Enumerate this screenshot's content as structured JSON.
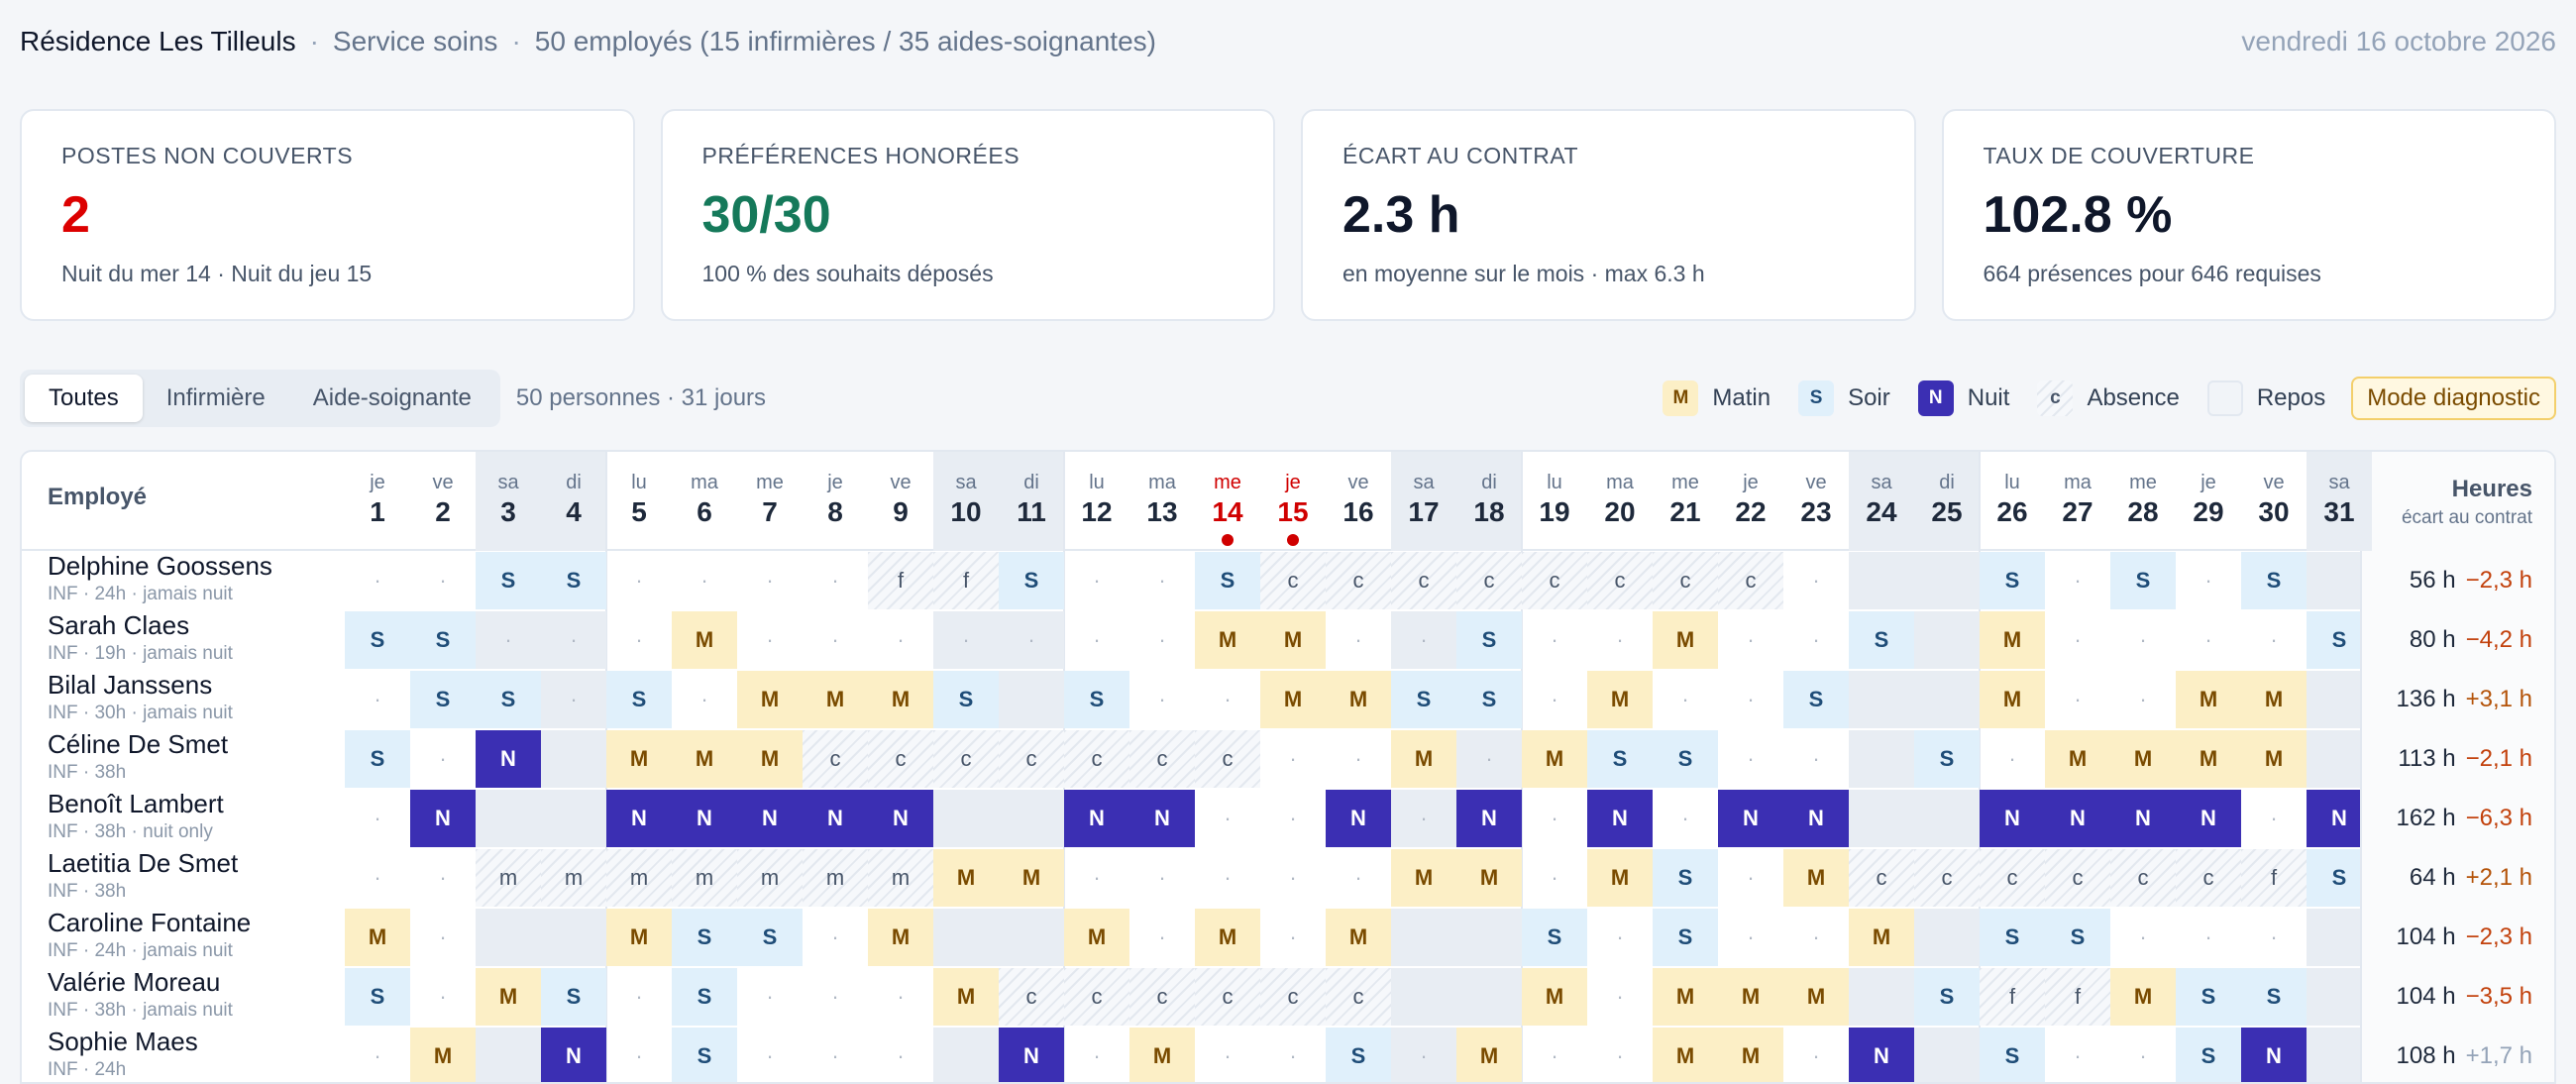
{
  "header": {
    "title": "Résidence Les Tilleuls",
    "service": "Service soins",
    "staff": "50 employés (15 infirmières / 35 aides-soignantes)",
    "date": "vendredi 16 octobre 2026"
  },
  "kpis": [
    {
      "label": "POSTES NON COUVERTS",
      "value": "2",
      "sub": "Nuit du mer 14 · Nuit du jeu 15",
      "tone": "red"
    },
    {
      "label": "PRÉFÉRENCES HONORÉES",
      "value": "30/30",
      "sub": "100 % des souhaits déposés",
      "tone": "green"
    },
    {
      "label": "ÉCART AU CONTRAT",
      "value": "2.3 h",
      "sub": "en moyenne sur le mois · max 6.3 h",
      "tone": ""
    },
    {
      "label": "TAUX DE COUVERTURE",
      "value": "102.8 %",
      "sub": "664 présences pour 646 requises",
      "tone": ""
    }
  ],
  "filters": {
    "all": "Toutes",
    "nurse": "Infirmière",
    "aide": "Aide-soignante",
    "count": "50 personnes · 31 jours"
  },
  "legend": {
    "matin": "Matin",
    "soir": "Soir",
    "nuit": "Nuit",
    "absence": "Absence",
    "repos": "Repos",
    "m_glyph": "M",
    "s_glyph": "S",
    "n_glyph": "N",
    "a_glyph": "c",
    "diagnostic": "Mode diagnostic",
    "colors": {
      "matin": "#fcefc6",
      "soir": "#e0f0fb",
      "nuit": "#3b2fb3",
      "absence": "#e3e8ef",
      "alert": "#d00000"
    }
  },
  "table": {
    "employee_header": "Employé",
    "hours_header": "Heures",
    "hours_sub": "écart au contrat",
    "days": [
      {
        "dn": "je",
        "dd": "1"
      },
      {
        "dn": "ve",
        "dd": "2"
      },
      {
        "dn": "sa",
        "dd": "3"
      },
      {
        "dn": "di",
        "dd": "4"
      },
      {
        "dn": "lu",
        "dd": "5"
      },
      {
        "dn": "ma",
        "dd": "6"
      },
      {
        "dn": "me",
        "dd": "7"
      },
      {
        "dn": "je",
        "dd": "8"
      },
      {
        "dn": "ve",
        "dd": "9"
      },
      {
        "dn": "sa",
        "dd": "10"
      },
      {
        "dn": "di",
        "dd": "11"
      },
      {
        "dn": "lu",
        "dd": "12"
      },
      {
        "dn": "ma",
        "dd": "13"
      },
      {
        "dn": "me",
        "dd": "14"
      },
      {
        "dn": "je",
        "dd": "15"
      },
      {
        "dn": "ve",
        "dd": "16"
      },
      {
        "dn": "sa",
        "dd": "17"
      },
      {
        "dn": "di",
        "dd": "18"
      },
      {
        "dn": "lu",
        "dd": "19"
      },
      {
        "dn": "ma",
        "dd": "20"
      },
      {
        "dn": "me",
        "dd": "21"
      },
      {
        "dn": "je",
        "dd": "22"
      },
      {
        "dn": "ve",
        "dd": "23"
      },
      {
        "dn": "sa",
        "dd": "24"
      },
      {
        "dn": "di",
        "dd": "25"
      },
      {
        "dn": "lu",
        "dd": "26"
      },
      {
        "dn": "ma",
        "dd": "27"
      },
      {
        "dn": "me",
        "dd": "28"
      },
      {
        "dn": "je",
        "dd": "29"
      },
      {
        "dn": "ve",
        "dd": "30"
      },
      {
        "dn": "sa",
        "dd": "31"
      }
    ],
    "rows": [
      {
        "name": "Delphine Goossens",
        "meta": "INF · 24h · jamais nuit",
        "hours": "56 h",
        "ecart": "−2,3 h",
        "tone": "neg",
        "shifts": [
          "·",
          "·",
          "S",
          "S",
          "·",
          "·",
          "·",
          "·",
          "f",
          "f",
          "S",
          "·",
          "·",
          "S",
          "c",
          "c",
          "c",
          "c",
          "c",
          "c",
          "c",
          "c",
          "·",
          "",
          "",
          "S",
          "·",
          "S",
          "·",
          "S",
          ""
        ]
      },
      {
        "name": "Sarah Claes",
        "meta": "INF · 19h · jamais nuit",
        "hours": "80 h",
        "ecart": "−4,2 h",
        "tone": "neg",
        "shifts": [
          "S",
          "S",
          "·",
          "·",
          "·",
          "M",
          "·",
          "·",
          "·",
          "·",
          "·",
          "·",
          "·",
          "M",
          "M",
          "·",
          "·",
          "S",
          "·",
          "·",
          "M",
          "·",
          "·",
          "S",
          "",
          "M",
          "·",
          "·",
          "·",
          "·",
          "S"
        ]
      },
      {
        "name": "Bilal Janssens",
        "meta": "INF · 30h · jamais nuit",
        "hours": "136 h",
        "ecart": "+3,1 h",
        "tone": "pos",
        "shifts": [
          "·",
          "S",
          "S",
          "·",
          "S",
          "·",
          "M",
          "M",
          "M",
          "S",
          "",
          "S",
          "·",
          "·",
          "M",
          "M",
          "S",
          "S",
          "·",
          "M",
          "·",
          "·",
          "S",
          "",
          "",
          "M",
          "·",
          "·",
          "M",
          "M",
          ""
        ]
      },
      {
        "name": "Céline De Smet",
        "meta": "INF · 38h",
        "hours": "113 h",
        "ecart": "−2,1 h",
        "tone": "neg",
        "shifts": [
          "S",
          "·",
          "N",
          "",
          "M",
          "M",
          "M",
          "c",
          "c",
          "c",
          "c",
          "c",
          "c",
          "c",
          "·",
          "·",
          "M",
          "·",
          "M",
          "S",
          "S",
          "·",
          "·",
          "",
          "S",
          "·",
          "M",
          "M",
          "M",
          "M",
          ""
        ]
      },
      {
        "name": "Benoît Lambert",
        "meta": "INF · 38h · nuit only",
        "hours": "162 h",
        "ecart": "−6,3 h",
        "tone": "neg",
        "shifts": [
          "·",
          "N",
          "",
          "",
          "N",
          "N",
          "N",
          "N",
          "N",
          "",
          "",
          "N",
          "N",
          "·",
          "·",
          "N",
          "·",
          "N",
          "·",
          "N",
          "·",
          "N",
          "N",
          "",
          "",
          "N",
          "N",
          "N",
          "N",
          "·",
          "N"
        ]
      },
      {
        "name": "Laetitia De Smet",
        "meta": "INF · 38h",
        "hours": "64 h",
        "ecart": "+2,1 h",
        "tone": "pos",
        "shifts": [
          "·",
          "·",
          "m",
          "m",
          "m",
          "m",
          "m",
          "m",
          "m",
          "M",
          "M",
          "·",
          "·",
          "·",
          "·",
          "·",
          "M",
          "M",
          "·",
          "M",
          "S",
          "·",
          "M",
          "c",
          "c",
          "c",
          "c",
          "c",
          "c",
          "f",
          "S"
        ]
      },
      {
        "name": "Caroline Fontaine",
        "meta": "INF · 24h · jamais nuit",
        "hours": "104 h",
        "ecart": "−2,3 h",
        "tone": "neg",
        "shifts": [
          "M",
          "·",
          "",
          "",
          "M",
          "S",
          "S",
          "·",
          "M",
          "",
          "",
          "M",
          "·",
          "M",
          "·",
          "M",
          "",
          "",
          "S",
          "·",
          "S",
          "·",
          "·",
          "M",
          "",
          "S",
          "S",
          "·",
          "·",
          "·",
          ""
        ]
      },
      {
        "name": "Valérie Moreau",
        "meta": "INF · 38h · jamais nuit",
        "hours": "104 h",
        "ecart": "−3,5 h",
        "tone": "neg",
        "shifts": [
          "S",
          "·",
          "M",
          "S",
          "·",
          "S",
          "·",
          "·",
          "·",
          "M",
          "c",
          "c",
          "c",
          "c",
          "c",
          "c",
          "",
          "",
          "M",
          "·",
          "M",
          "M",
          "M",
          "",
          "S",
          "f",
          "f",
          "M",
          "S",
          "S",
          ""
        ]
      },
      {
        "name": "Sophie Maes",
        "meta": "INF · 24h",
        "hours": "108 h",
        "ecart": "+1,7 h",
        "tone": "mute",
        "shifts": [
          "·",
          "M",
          "",
          "N",
          "·",
          "S",
          "·",
          "·",
          "·",
          "",
          "N",
          "·",
          "M",
          "·",
          "·",
          "S",
          "·",
          "M",
          "·",
          "·",
          "M",
          "M",
          "·",
          "N",
          "",
          "S",
          "·",
          "·",
          "S",
          "N",
          ""
        ]
      }
    ]
  }
}
